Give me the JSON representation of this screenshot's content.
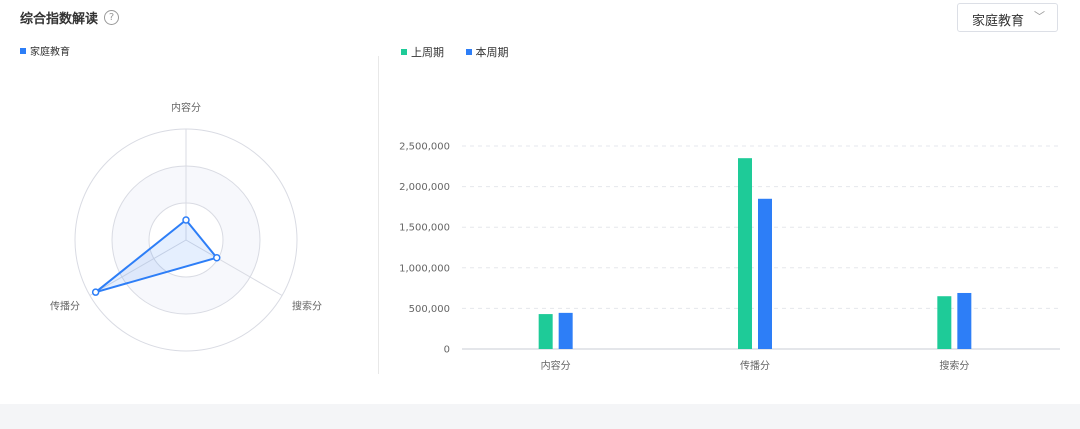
{
  "header": {
    "title": "综合指数解读",
    "help_icon": "question-circle-icon",
    "select_value": "家庭教育"
  },
  "chart_data": [
    {
      "type": "radar",
      "legend_position": "top-left",
      "indicators": [
        "内容分",
        "搜索分",
        "传播分"
      ],
      "series": [
        {
          "name": "家庭教育",
          "color": "#2d7ef7",
          "values": [
            0.18,
            0.32,
            0.94
          ]
        }
      ]
    },
    {
      "type": "bar",
      "legend_position": "top-left",
      "categories": [
        "内容分",
        "传播分",
        "搜索分"
      ],
      "series": [
        {
          "name": "上周期",
          "color": "#1ecb98",
          "values": [
            430000,
            2350000,
            650000
          ]
        },
        {
          "name": "本周期",
          "color": "#2d7ef7",
          "values": [
            445000,
            1850000,
            690000
          ]
        }
      ],
      "ylim": [
        0,
        2500000
      ],
      "yticks": [
        0,
        500000,
        1000000,
        1500000,
        2000000,
        2500000
      ],
      "ytick_labels": [
        "0",
        "500,000",
        "1,000,000",
        "1,500,000",
        "2,000,000",
        "2,500,000"
      ],
      "grid": true
    }
  ]
}
